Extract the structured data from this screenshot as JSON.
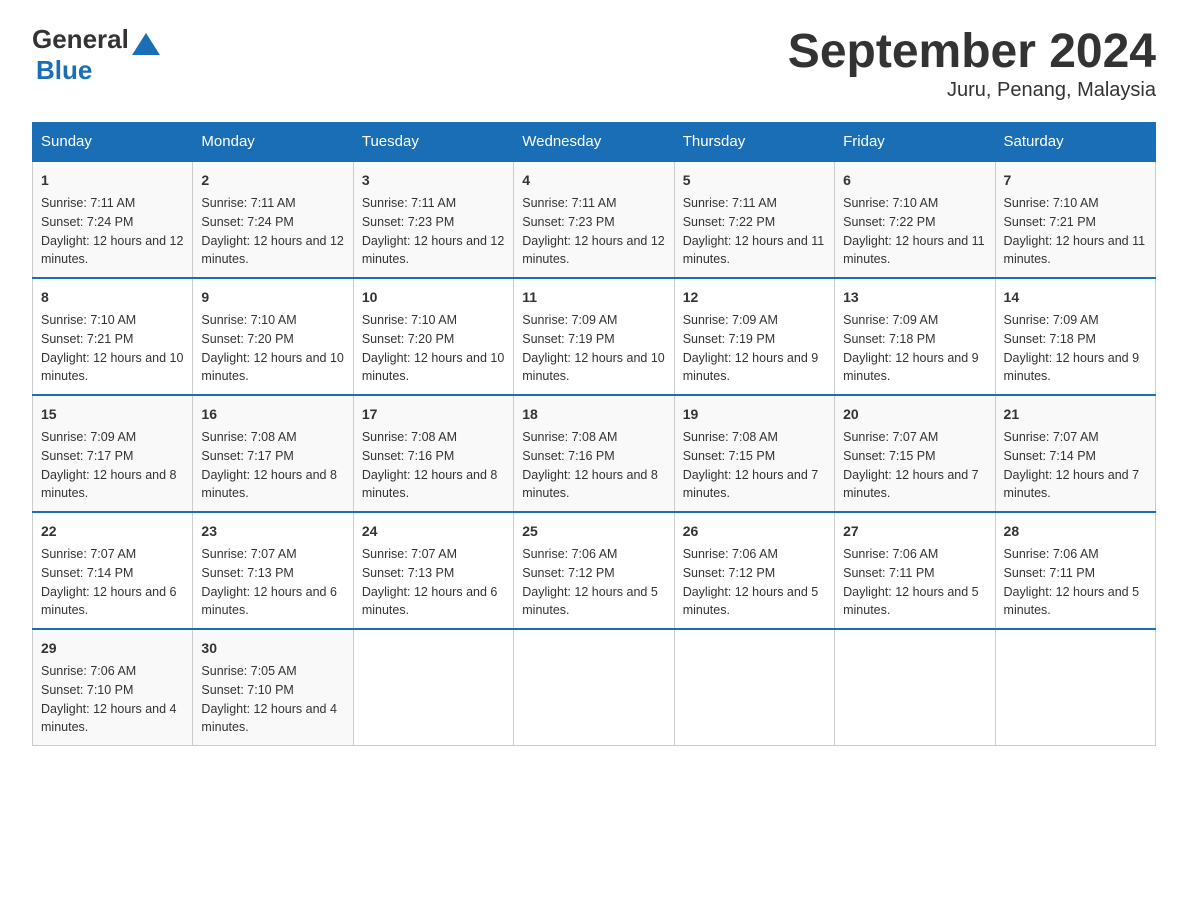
{
  "logo": {
    "general": "General",
    "blue": "Blue"
  },
  "title": "September 2024",
  "subtitle": "Juru, Penang, Malaysia",
  "headers": [
    "Sunday",
    "Monday",
    "Tuesday",
    "Wednesday",
    "Thursday",
    "Friday",
    "Saturday"
  ],
  "weeks": [
    [
      {
        "day": "1",
        "sunrise": "Sunrise: 7:11 AM",
        "sunset": "Sunset: 7:24 PM",
        "daylight": "Daylight: 12 hours and 12 minutes."
      },
      {
        "day": "2",
        "sunrise": "Sunrise: 7:11 AM",
        "sunset": "Sunset: 7:24 PM",
        "daylight": "Daylight: 12 hours and 12 minutes."
      },
      {
        "day": "3",
        "sunrise": "Sunrise: 7:11 AM",
        "sunset": "Sunset: 7:23 PM",
        "daylight": "Daylight: 12 hours and 12 minutes."
      },
      {
        "day": "4",
        "sunrise": "Sunrise: 7:11 AM",
        "sunset": "Sunset: 7:23 PM",
        "daylight": "Daylight: 12 hours and 12 minutes."
      },
      {
        "day": "5",
        "sunrise": "Sunrise: 7:11 AM",
        "sunset": "Sunset: 7:22 PM",
        "daylight": "Daylight: 12 hours and 11 minutes."
      },
      {
        "day": "6",
        "sunrise": "Sunrise: 7:10 AM",
        "sunset": "Sunset: 7:22 PM",
        "daylight": "Daylight: 12 hours and 11 minutes."
      },
      {
        "day": "7",
        "sunrise": "Sunrise: 7:10 AM",
        "sunset": "Sunset: 7:21 PM",
        "daylight": "Daylight: 12 hours and 11 minutes."
      }
    ],
    [
      {
        "day": "8",
        "sunrise": "Sunrise: 7:10 AM",
        "sunset": "Sunset: 7:21 PM",
        "daylight": "Daylight: 12 hours and 10 minutes."
      },
      {
        "day": "9",
        "sunrise": "Sunrise: 7:10 AM",
        "sunset": "Sunset: 7:20 PM",
        "daylight": "Daylight: 12 hours and 10 minutes."
      },
      {
        "day": "10",
        "sunrise": "Sunrise: 7:10 AM",
        "sunset": "Sunset: 7:20 PM",
        "daylight": "Daylight: 12 hours and 10 minutes."
      },
      {
        "day": "11",
        "sunrise": "Sunrise: 7:09 AM",
        "sunset": "Sunset: 7:19 PM",
        "daylight": "Daylight: 12 hours and 10 minutes."
      },
      {
        "day": "12",
        "sunrise": "Sunrise: 7:09 AM",
        "sunset": "Sunset: 7:19 PM",
        "daylight": "Daylight: 12 hours and 9 minutes."
      },
      {
        "day": "13",
        "sunrise": "Sunrise: 7:09 AM",
        "sunset": "Sunset: 7:18 PM",
        "daylight": "Daylight: 12 hours and 9 minutes."
      },
      {
        "day": "14",
        "sunrise": "Sunrise: 7:09 AM",
        "sunset": "Sunset: 7:18 PM",
        "daylight": "Daylight: 12 hours and 9 minutes."
      }
    ],
    [
      {
        "day": "15",
        "sunrise": "Sunrise: 7:09 AM",
        "sunset": "Sunset: 7:17 PM",
        "daylight": "Daylight: 12 hours and 8 minutes."
      },
      {
        "day": "16",
        "sunrise": "Sunrise: 7:08 AM",
        "sunset": "Sunset: 7:17 PM",
        "daylight": "Daylight: 12 hours and 8 minutes."
      },
      {
        "day": "17",
        "sunrise": "Sunrise: 7:08 AM",
        "sunset": "Sunset: 7:16 PM",
        "daylight": "Daylight: 12 hours and 8 minutes."
      },
      {
        "day": "18",
        "sunrise": "Sunrise: 7:08 AM",
        "sunset": "Sunset: 7:16 PM",
        "daylight": "Daylight: 12 hours and 8 minutes."
      },
      {
        "day": "19",
        "sunrise": "Sunrise: 7:08 AM",
        "sunset": "Sunset: 7:15 PM",
        "daylight": "Daylight: 12 hours and 7 minutes."
      },
      {
        "day": "20",
        "sunrise": "Sunrise: 7:07 AM",
        "sunset": "Sunset: 7:15 PM",
        "daylight": "Daylight: 12 hours and 7 minutes."
      },
      {
        "day": "21",
        "sunrise": "Sunrise: 7:07 AM",
        "sunset": "Sunset: 7:14 PM",
        "daylight": "Daylight: 12 hours and 7 minutes."
      }
    ],
    [
      {
        "day": "22",
        "sunrise": "Sunrise: 7:07 AM",
        "sunset": "Sunset: 7:14 PM",
        "daylight": "Daylight: 12 hours and 6 minutes."
      },
      {
        "day": "23",
        "sunrise": "Sunrise: 7:07 AM",
        "sunset": "Sunset: 7:13 PM",
        "daylight": "Daylight: 12 hours and 6 minutes."
      },
      {
        "day": "24",
        "sunrise": "Sunrise: 7:07 AM",
        "sunset": "Sunset: 7:13 PM",
        "daylight": "Daylight: 12 hours and 6 minutes."
      },
      {
        "day": "25",
        "sunrise": "Sunrise: 7:06 AM",
        "sunset": "Sunset: 7:12 PM",
        "daylight": "Daylight: 12 hours and 5 minutes."
      },
      {
        "day": "26",
        "sunrise": "Sunrise: 7:06 AM",
        "sunset": "Sunset: 7:12 PM",
        "daylight": "Daylight: 12 hours and 5 minutes."
      },
      {
        "day": "27",
        "sunrise": "Sunrise: 7:06 AM",
        "sunset": "Sunset: 7:11 PM",
        "daylight": "Daylight: 12 hours and 5 minutes."
      },
      {
        "day": "28",
        "sunrise": "Sunrise: 7:06 AM",
        "sunset": "Sunset: 7:11 PM",
        "daylight": "Daylight: 12 hours and 5 minutes."
      }
    ],
    [
      {
        "day": "29",
        "sunrise": "Sunrise: 7:06 AM",
        "sunset": "Sunset: 7:10 PM",
        "daylight": "Daylight: 12 hours and 4 minutes."
      },
      {
        "day": "30",
        "sunrise": "Sunrise: 7:05 AM",
        "sunset": "Sunset: 7:10 PM",
        "daylight": "Daylight: 12 hours and 4 minutes."
      },
      null,
      null,
      null,
      null,
      null
    ]
  ]
}
